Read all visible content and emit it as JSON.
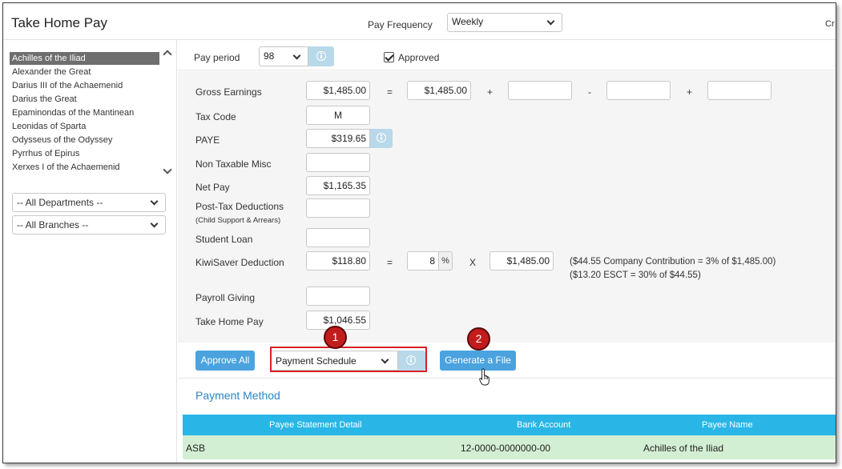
{
  "header": {
    "title": "Take Home Pay",
    "pay_frequency_label": "Pay Frequency",
    "pay_frequency_value": "Weekly",
    "cut_text": "Cr"
  },
  "employees": [
    "Achilles of the Iliad",
    "Alexander the Great",
    "Darius III of the Achaemenid",
    "Darius the Great",
    "Epaminondas of the Mantinean",
    "Leonidas of Sparta",
    "Odysseus of the Odyssey",
    "Pyrrhus of Epirus",
    "Xerxes I of the Achaemenid"
  ],
  "filters": {
    "departments": "-- All Departments --",
    "branches": "-- All Branches --"
  },
  "pay_period": {
    "label": "Pay period",
    "value": "98",
    "approved_label": "Approved"
  },
  "form": {
    "gross_earnings": {
      "label": "Gross Earnings",
      "value": "$1,485.00",
      "calc_value": "$1,485.00",
      "op_eq": "=",
      "op_plus1": "+",
      "op_minus": "-",
      "op_plus2": "+"
    },
    "tax_code": {
      "label": "Tax Code",
      "value": "M"
    },
    "paye": {
      "label": "PAYE",
      "value": "$319.65"
    },
    "non_taxable_misc": {
      "label": "Non Taxable Misc",
      "value": ""
    },
    "net_pay": {
      "label": "Net Pay",
      "value": "$1,165.35"
    },
    "post_tax": {
      "label": "Post-Tax Deductions",
      "sublabel": "(Child Support & Arrears)",
      "value": ""
    },
    "student_loan": {
      "label": "Student Loan",
      "value": ""
    },
    "kiwisaver": {
      "label": "KiwiSaver Deduction",
      "value": "$118.80",
      "op_eq": "=",
      "rate": "8",
      "pct": "%",
      "op_x": "X",
      "base": "$1,485.00",
      "note1": "($44.55 Company Contribution = 3% of $1,485.00)",
      "note2": "($13.20 ESCT = 30% of $44.55)"
    },
    "payroll_giving": {
      "label": "Payroll Giving",
      "value": ""
    },
    "take_home_pay": {
      "label": "Take Home Pay",
      "value": "$1,046.55"
    }
  },
  "actions": {
    "approve_all": "Approve All",
    "payment_schedule": "Payment Schedule",
    "generate_file": "Generate a File",
    "marker1": "1",
    "marker2": "2"
  },
  "payment_method": {
    "title": "Payment Method",
    "columns": [
      "Payee Statement Detail",
      "Bank Account",
      "Payee Name"
    ],
    "rows": [
      {
        "detail": "ASB",
        "account": "12-0000-0000000-00",
        "name": "Achilles of the Iliad"
      }
    ]
  },
  "colors": {
    "accent": "#4aa3df",
    "table_header": "#29b6e6",
    "row_highlight": "#d3efd3",
    "annotation": "#d81f26"
  }
}
